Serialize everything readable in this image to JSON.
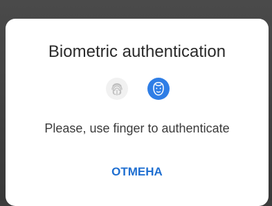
{
  "dialog": {
    "title": "Biometric authentication",
    "message": "Please, use finger to authenticate",
    "cancel_label": "ОТМЕНА",
    "icons": [
      {
        "name": "fingerprint-icon",
        "state": "inactive"
      },
      {
        "name": "face-icon",
        "state": "active"
      }
    ]
  },
  "colors": {
    "accent": "#2f7ee6",
    "button_text": "#1f6fd1",
    "backdrop": "#3d3d3d",
    "dialog_bg": "#ffffff"
  }
}
